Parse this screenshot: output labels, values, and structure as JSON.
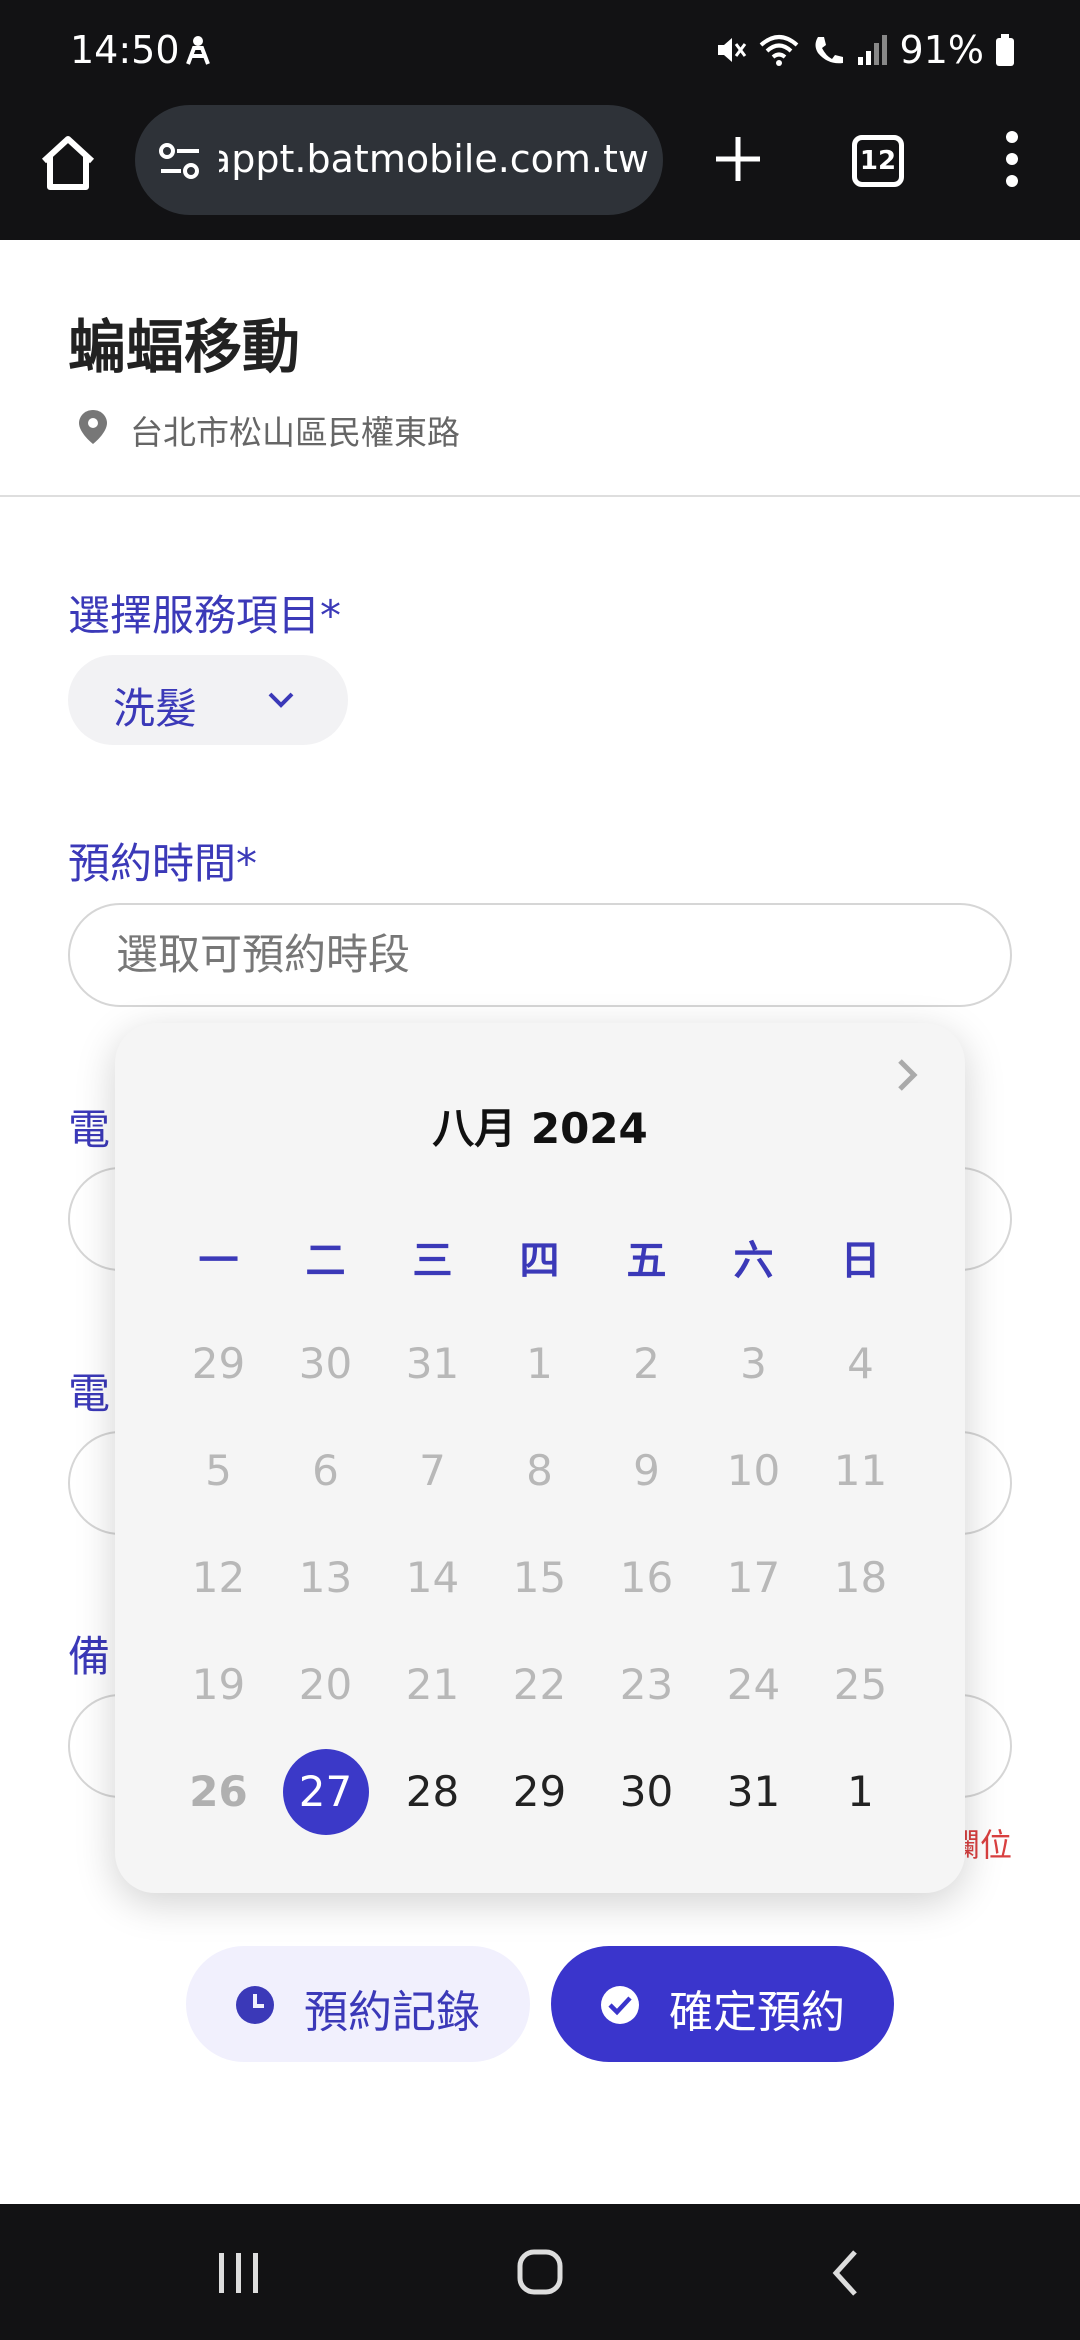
{
  "status_bar": {
    "time": "14:50",
    "battery": "91%"
  },
  "browser": {
    "url": "appt.batmobile.com.tw",
    "tab_count": "12"
  },
  "header": {
    "store_name": "蝙蝠移動",
    "address": "台北市松山區民權東路"
  },
  "form": {
    "service_label": "選擇服務項目*",
    "service_value": "洗髮",
    "time_label": "預約時間*",
    "time_placeholder": "選取可預約時段",
    "hidden_label_1": "電",
    "hidden_label_2": "電",
    "hidden_label_3": "備",
    "hidden_note": "備註欄位"
  },
  "calendar": {
    "title": "八月 2024",
    "weekdays": [
      "一",
      "二",
      "三",
      "四",
      "五",
      "六",
      "日"
    ],
    "weeks": [
      [
        "29",
        "30",
        "31",
        "1",
        "2",
        "3",
        "4"
      ],
      [
        "5",
        "6",
        "7",
        "8",
        "9",
        "10",
        "11"
      ],
      [
        "12",
        "13",
        "14",
        "15",
        "16",
        "17",
        "18"
      ],
      [
        "19",
        "20",
        "21",
        "22",
        "23",
        "24",
        "25"
      ],
      [
        "26",
        "27",
        "28",
        "29",
        "30",
        "31",
        "1"
      ]
    ],
    "selected_day": "27",
    "today_day": "26"
  },
  "actions": {
    "history_label": "預約記錄",
    "confirm_label": "確定預約"
  },
  "colors": {
    "accent": "#3b39c8",
    "dark_bar": "#121214"
  }
}
